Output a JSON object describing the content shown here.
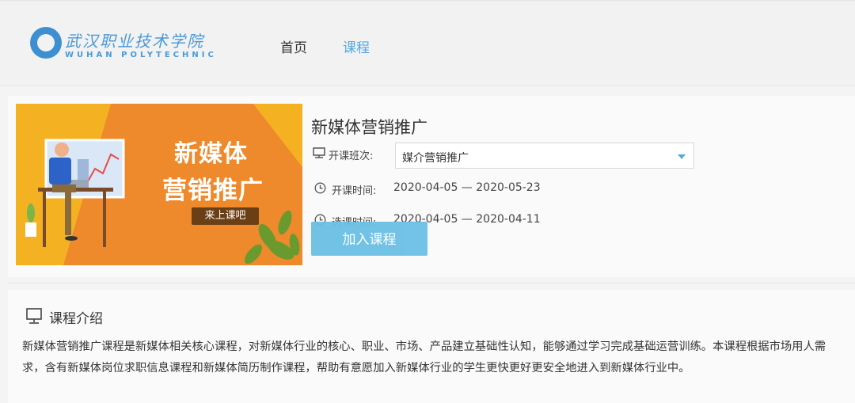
{
  "header": {
    "logo_cn": "武汉职业技术学院",
    "logo_en": "WUHAN POLYTECHNIC",
    "nav": {
      "home": "首页",
      "course": "课程"
    }
  },
  "banner": {
    "line1": "新媒体",
    "line2": "营销推广",
    "badge": "来上课吧"
  },
  "course": {
    "title": "新媒体营销推广",
    "class_label": "开课班次:",
    "class_value": "媒介营销推广",
    "start_label": "开课时间:",
    "start_value": "2020-04-05 — 2020-05-23",
    "select_label": "选课时间:",
    "select_value": "2020-04-05 — 2020-04-11",
    "join_button": "加入课程"
  },
  "intro": {
    "title": "课程介绍",
    "text": "新媒体营销推广课程是新媒体相关核心课程，对新媒体行业的核心、职业、市场、产品建立基础性认知，能够通过学习完成基础运营训练。本课程根据市场用人需求，含有新媒体岗位求职信息课程和新媒体简历制作课程，帮助有意愿加入新媒体行业的学生更快更好更安全地进入到新媒体行业中。"
  },
  "colors": {
    "accent": "#55a8e0",
    "button": "#6dc0e6",
    "banner_orange": "#ee8a2c",
    "banner_yellow": "#f4b223"
  }
}
